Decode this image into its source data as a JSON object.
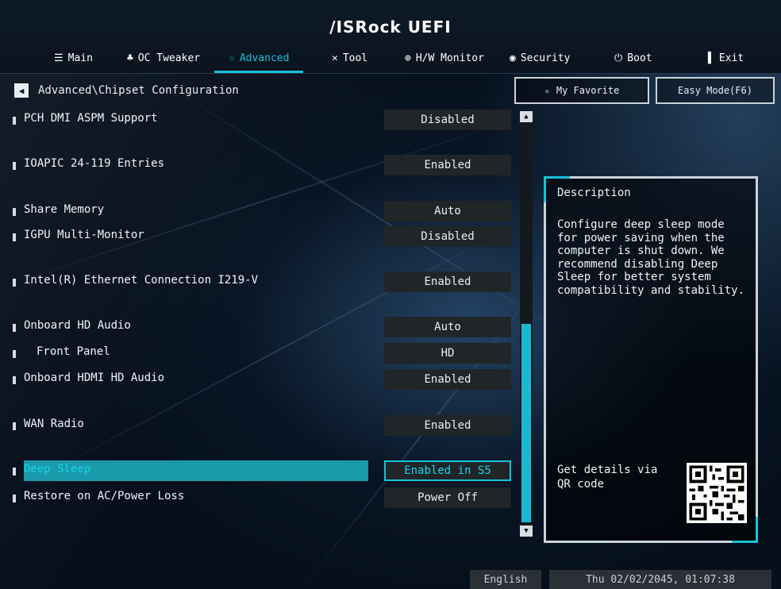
{
  "header": {
    "logo_text": "/ISRock UEFI"
  },
  "tabs": [
    {
      "icon": "list-icon",
      "glyph": "☰",
      "label": "Main",
      "active": false
    },
    {
      "icon": "oc-tweaker-icon",
      "glyph": "♣",
      "label": "OC Tweaker",
      "active": false
    },
    {
      "icon": "star-icon",
      "glyph": "☆",
      "label": "Advanced",
      "active": true
    },
    {
      "icon": "tool-icon",
      "glyph": "✕",
      "label": "Tool",
      "active": false
    },
    {
      "icon": "monitor-icon",
      "glyph": "⊕",
      "label": "H/W Monitor",
      "active": false
    },
    {
      "icon": "security-icon",
      "glyph": "◉",
      "label": "Security",
      "active": false
    },
    {
      "icon": "power-icon",
      "glyph": "⏻",
      "label": "Boot",
      "active": false
    },
    {
      "icon": "exit-icon",
      "glyph": "▌",
      "label": "Exit",
      "active": false
    }
  ],
  "breadcrumb": {
    "back_glyph": "◀",
    "path": "Advanced\\Chipset Configuration"
  },
  "buttons": {
    "favorite_label": "My Favorite",
    "easy_mode_label": "Easy Mode(F6)"
  },
  "settings": [
    {
      "label": "PCH DMI ASPM Support",
      "value": "Disabled"
    },
    {
      "label": "IOAPIC 24-119 Entries",
      "value": "Enabled"
    },
    {
      "label": "Share Memory",
      "value": "Auto"
    },
    {
      "label": "IGPU Multi-Monitor",
      "value": "Disabled"
    },
    {
      "label": "Intel(R) Ethernet Connection I219-V",
      "value": "Enabled"
    },
    {
      "label": "Onboard HD Audio",
      "value": "Auto"
    },
    {
      "label": "Front Panel",
      "value": "HD"
    },
    {
      "label": "Onboard HDMI HD Audio",
      "value": "Enabled"
    },
    {
      "label": "WAN Radio",
      "value": "Enabled"
    },
    {
      "label": "Deep Sleep",
      "value": "Enabled in S5",
      "selected": true
    },
    {
      "label": "Restore on AC/Power Loss",
      "value": "Power Off"
    }
  ],
  "description": {
    "title": "Description",
    "text": "Configure deep sleep mode for power saving when the computer is shut down. We recommend disabling Deep Sleep for better system compatibility and stability.",
    "qr_label": "Get details via QR code"
  },
  "footer": {
    "language": "English",
    "datetime": "Thu 02/02/2045, 01:07:38"
  },
  "colors": {
    "accent": "#18c2d8",
    "selection": "#1a9aab",
    "value_bg": "#202528"
  }
}
